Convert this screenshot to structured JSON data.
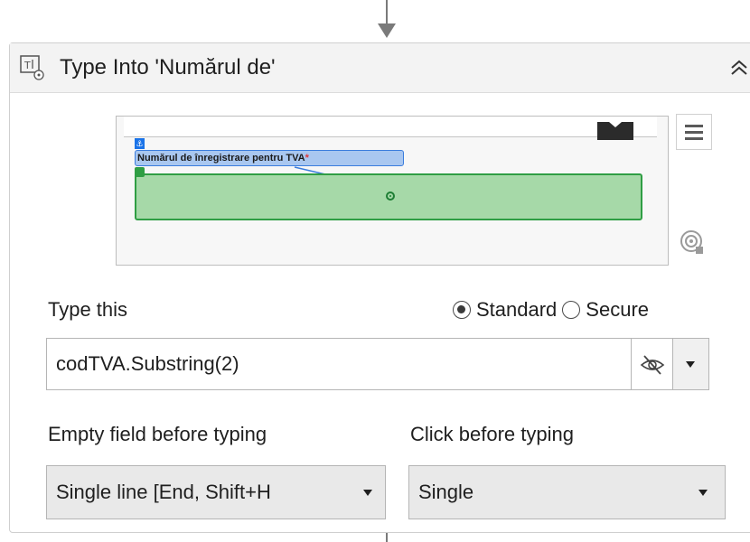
{
  "activity": {
    "title": "Type Into 'Numărul de'",
    "icon": "type-into-icon",
    "collapse_icon": "double-chevron-up-icon"
  },
  "preview": {
    "anchor_label": "Numărul de înregistrare pentru TVA",
    "anchor_required_mark": "*",
    "menu_icon": "hamburger-menu-icon",
    "indicate_icon": "target-indicate-icon"
  },
  "type_this": {
    "label": "Type this",
    "mode_options": [
      "Standard",
      "Secure"
    ],
    "selected_mode": "Standard",
    "value": "codTVA.Substring(2)",
    "visibility_icon": "eye-slash-icon",
    "dropdown_icon": "caret-down-icon"
  },
  "empty_field": {
    "label": "Empty field before typing",
    "selected": "Single line [End, Shift+H"
  },
  "click_before": {
    "label": "Click before typing",
    "selected": "Single"
  },
  "colors": {
    "anchor_fill": "#a9c7f0",
    "anchor_border": "#3b7ddd",
    "target_fill": "#a6d9a8",
    "target_border": "#2f9e44"
  }
}
